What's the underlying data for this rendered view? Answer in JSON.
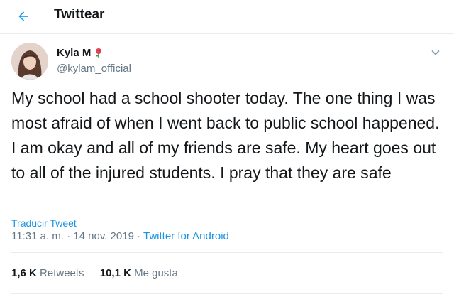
{
  "header": {
    "title": "Twittear",
    "back_icon": "arrow-left-icon"
  },
  "tweet": {
    "author_name": "Kyla M",
    "author_emoji_icon": "rose-icon",
    "author_handle": "@kylam_official",
    "text": "My school had a school shooter today. The one thing I was most afraid of when I went back to public school happened. I am okay and all of my friends are safe. My heart goes out to all of the injured students. I pray that they are safe",
    "translate_label": "Traducir Tweet",
    "time": "11:31 a. m.",
    "date": "14 nov. 2019",
    "separator": " · ",
    "source": "Twitter for Android",
    "caret_icon": "chevron-down-icon"
  },
  "stats": {
    "retweets_count": "1,6 K",
    "retweets_label": "Retweets",
    "likes_count": "10,1 K",
    "likes_label": "Me gusta"
  },
  "colors": {
    "accent": "#1b95e0",
    "muted": "#657786",
    "text": "#14171a",
    "divider": "#e6ecf0"
  }
}
